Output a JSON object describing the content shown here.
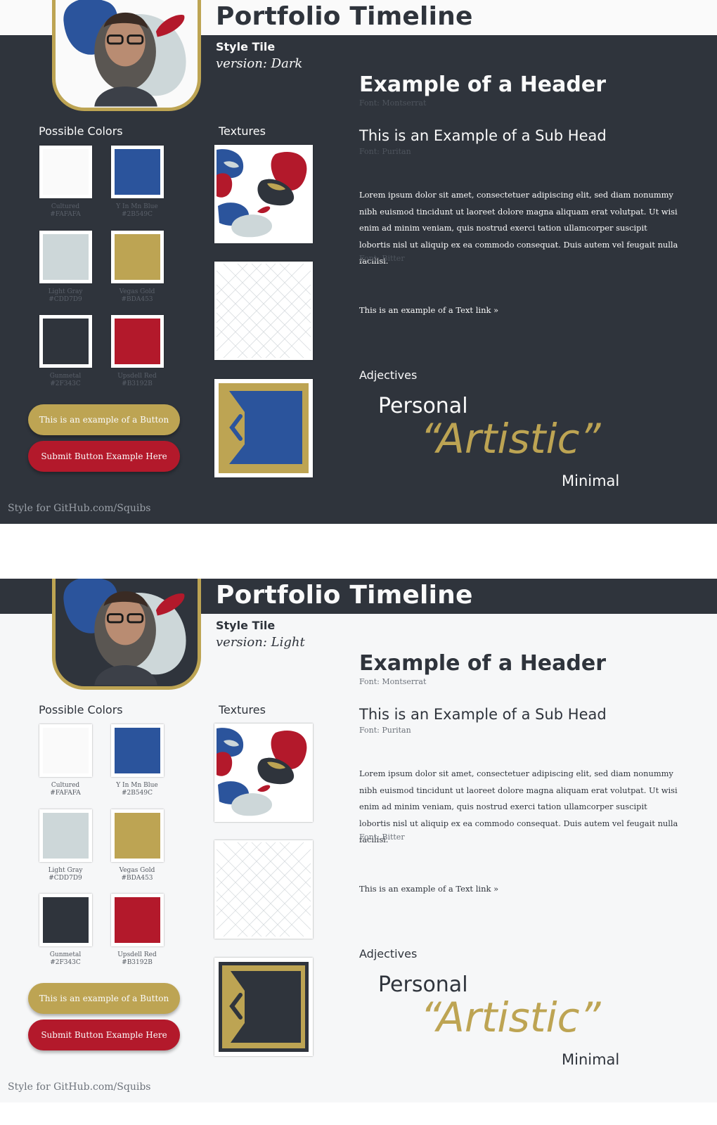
{
  "tiles": [
    {
      "theme": "dark",
      "title": "Portfolio Timeline",
      "subtitle": "Style Tile",
      "version_prefix": "version:",
      "version_value": "Dark",
      "colors_heading": "Possible Colors",
      "textures_heading": "Textures",
      "header_example": "Example of a Header",
      "header_font_note": "Font: Montserrat",
      "subhead_example": "This is an Example of a Sub Head",
      "subhead_font_note": "Font: Puritan",
      "body_text": "Lorem ipsum dolor sit amet, consectetuer adipiscing elit, sed diam nonummy nibh euismod tincidunt ut laoreet dolore magna aliquam erat volutpat. Ut wisi enim ad minim veniam, quis nostrud exerci tation ullamcorper suscipit lobortis nisl ut aliquip ex ea commodo consequat. Duis autem vel feugait nulla facilisi.",
      "body_font_note": "Font: Bitter",
      "text_link": "This is an example of a Text link »",
      "adjectives_heading": "Adjectives",
      "adjective_1": "Personal",
      "adjective_2": "“Artistic”",
      "adjective_3": "Minimal",
      "button_primary": "This is an example of a Button",
      "button_submit": "Submit Button Example Here",
      "footer": "Style for GitHub.com/Squibs"
    },
    {
      "theme": "light",
      "title": "Portfolio Timeline",
      "subtitle": "Style Tile",
      "version_prefix": "version:",
      "version_value": "Light",
      "colors_heading": "Possible Colors",
      "textures_heading": "Textures",
      "header_example": "Example of a Header",
      "header_font_note": "Font: Montserrat",
      "subhead_example": "This is an Example of a Sub Head",
      "subhead_font_note": "Font: Puritan",
      "body_text": "Lorem ipsum dolor sit amet, consectetuer adipiscing elit, sed diam nonummy nibh euismod tincidunt ut laoreet dolore magna aliquam erat volutpat. Ut wisi enim ad minim veniam, quis nostrud exerci tation ullamcorper suscipit lobortis nisl ut aliquip ex ea commodo consequat. Duis autem vel feugait nulla facilisi.",
      "body_font_note": "Font: Bitter",
      "text_link": "This is an example of a Text link »",
      "adjectives_heading": "Adjectives",
      "adjective_1": "Personal",
      "adjective_2": "“Artistic”",
      "adjective_3": "Minimal",
      "button_primary": "This is an example of a Button",
      "button_submit": "Submit Button Example Here",
      "footer": "Style for GitHub.com/Squibs"
    }
  ],
  "colors": [
    {
      "name": "Cultured",
      "hex": "#FAFAFA"
    },
    {
      "name": "Y In Mn Blue",
      "hex": "#2B549C"
    },
    {
      "name": "Light Gray",
      "hex": "#CDD7D9"
    },
    {
      "name": "Vegas Gold",
      "hex": "#BDA453"
    },
    {
      "name": "Gunmetal",
      "hex": "#2F343C"
    },
    {
      "name": "Upsdell Red",
      "hex": "#B3192B"
    }
  ]
}
